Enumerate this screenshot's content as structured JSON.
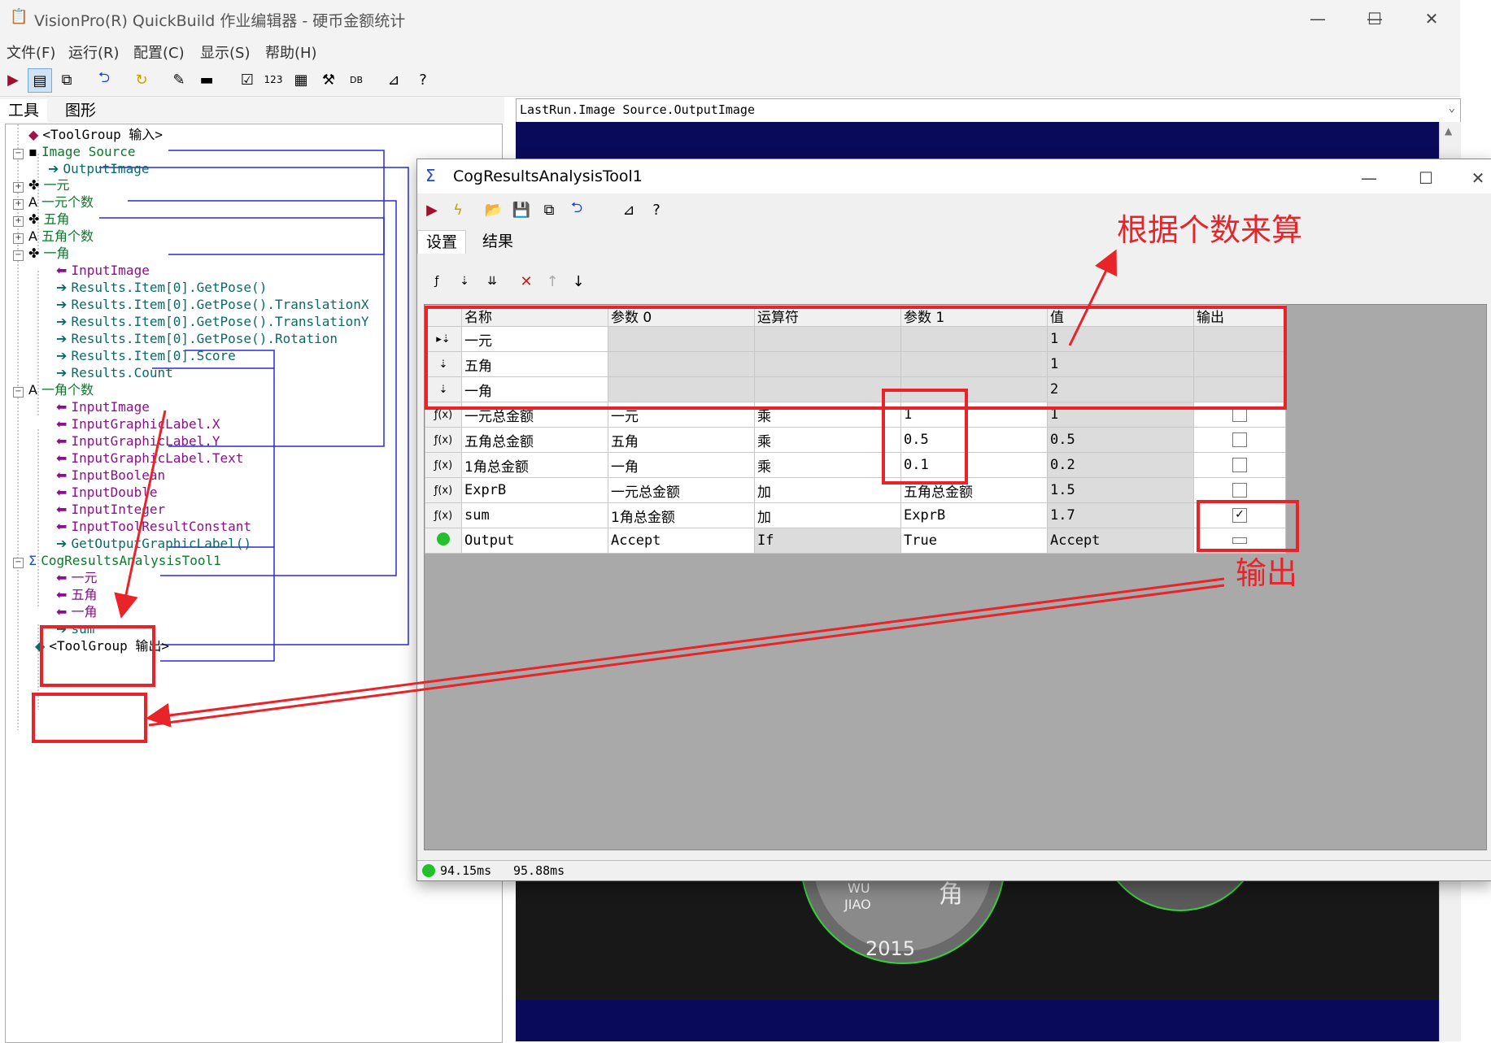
{
  "main_window": {
    "title": "VisionPro(R) QuickBuild 作业编辑器 - 硬币金额统计",
    "controls": [
      "—",
      "☐",
      "✕"
    ]
  },
  "menu": [
    "文件(F)",
    "运行(R)",
    "配置(C)",
    "显示(S)",
    "帮助(H)"
  ],
  "left_tabs": [
    "工具",
    "图形"
  ],
  "image_source_selector": "LastRun.Image Source.OutputImage",
  "tree": [
    {
      "text": "<ToolGroup 输入>",
      "color": "black"
    },
    {
      "text": "Image Source",
      "color": "green"
    },
    {
      "text": "OutputImage",
      "color": "teal"
    },
    {
      "text": "一元",
      "color": "green"
    },
    {
      "text": "一元个数",
      "color": "green"
    },
    {
      "text": "五角",
      "color": "green"
    },
    {
      "text": "五角个数",
      "color": "green"
    },
    {
      "text": "一角",
      "color": "green"
    },
    {
      "text": "InputImage",
      "color": "purple"
    },
    {
      "text": "Results.Item[0].GetPose()",
      "color": "teal"
    },
    {
      "text": "Results.Item[0].GetPose().TranslationX",
      "color": "teal"
    },
    {
      "text": "Results.Item[0].GetPose().TranslationY",
      "color": "teal"
    },
    {
      "text": "Results.Item[0].GetPose().Rotation",
      "color": "teal"
    },
    {
      "text": "Results.Item[0].Score",
      "color": "teal"
    },
    {
      "text": "Results.Count",
      "color": "teal"
    },
    {
      "text": "一角个数",
      "color": "green"
    },
    {
      "text": "InputImage",
      "color": "purple"
    },
    {
      "text": "InputGraphicLabel.X",
      "color": "purple"
    },
    {
      "text": "InputGraphicLabel.Y",
      "color": "purple"
    },
    {
      "text": "InputGraphicLabel.Text",
      "color": "purple"
    },
    {
      "text": "InputBoolean",
      "color": "purple"
    },
    {
      "text": "InputDouble",
      "color": "purple"
    },
    {
      "text": "InputInteger",
      "color": "purple"
    },
    {
      "text": "InputToolResultConstant",
      "color": "purple"
    },
    {
      "text": "GetOutputGraphicLabel()",
      "color": "teal"
    },
    {
      "text": "CogResultsAnalysisTool1",
      "color": "green"
    },
    {
      "text": "一元",
      "color": "purple"
    },
    {
      "text": "五角",
      "color": "purple"
    },
    {
      "text": "一角",
      "color": "purple"
    },
    {
      "text": "sum",
      "color": "teal"
    },
    {
      "text": "<ToolGroup 输出>",
      "color": "black"
    }
  ],
  "dialog": {
    "title": "CogResultsAnalysisTool1",
    "tabs": [
      "设置",
      "结果"
    ],
    "columns": [
      "名称",
      "参数 0",
      "运算符",
      "参数 1",
      "值",
      "输出"
    ],
    "rows": [
      {
        "marker": "input",
        "name": "一元",
        "arg0": "",
        "op": "",
        "arg1": "",
        "value": "1",
        "output": null
      },
      {
        "marker": "input",
        "name": "五角",
        "arg0": "",
        "op": "",
        "arg1": "",
        "value": "1",
        "output": null
      },
      {
        "marker": "input",
        "name": "一角",
        "arg0": "",
        "op": "",
        "arg1": "",
        "value": "2",
        "output": null
      },
      {
        "marker": "fx",
        "name": "一元总金额",
        "arg0": "一元",
        "op": "乘",
        "arg1": "1",
        "value": "1",
        "output": false
      },
      {
        "marker": "fx",
        "name": "五角总金额",
        "arg0": "五角",
        "op": "乘",
        "arg1": "0.5",
        "value": "0.5",
        "output": false
      },
      {
        "marker": "fx",
        "name": "1角总金额",
        "arg0": "一角",
        "op": "乘",
        "arg1": "0.1",
        "value": "0.2",
        "output": false
      },
      {
        "marker": "fx",
        "name": "ExprB",
        "arg0": "一元总金额",
        "op": "加",
        "arg1": "五角总金额",
        "value": "1.5",
        "output": false
      },
      {
        "marker": "fx",
        "name": "sum",
        "arg0": "1角总金额",
        "op": "加",
        "arg1": "ExprB",
        "value": "1.7",
        "output": true
      },
      {
        "marker": "status",
        "name": "Output",
        "arg0": "Accept",
        "op": "If",
        "arg1": "True",
        "value": "Accept",
        "output": false
      }
    ],
    "status": [
      "94.15ms",
      "95.88ms"
    ]
  },
  "annotations": {
    "count_note": "根据个数来算",
    "output_note": "输出"
  },
  "coin_text": [
    "WU",
    "JIAO",
    "角",
    "2015"
  ],
  "colors": {
    "annotation": "#e8232a",
    "image_bg": "#0a0a5a",
    "link_line": "#2a2ad8"
  }
}
